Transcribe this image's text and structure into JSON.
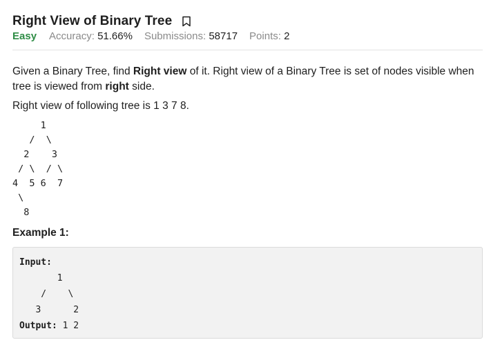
{
  "problem": {
    "title": "Right View of Binary Tree",
    "difficulty": "Easy",
    "accuracy_label": "Accuracy:",
    "accuracy_value": "51.66%",
    "submissions_label": "Submissions:",
    "submissions_value": "58717",
    "points_label": "Points:",
    "points_value": "2"
  },
  "description": {
    "p1_part1": "Given a Binary Tree, find ",
    "p1_bold1": "Right view",
    "p1_part2": " of it. Right view of a Binary Tree is set of nodes visible when tree is viewed from ",
    "p1_bold2": "right",
    "p1_part3": " side.",
    "p2": "Right view of following tree is 1 3 7 8.",
    "tree_diagram": "     1\n   /  \\\n  2    3\n / \\  / \\\n4  5 6  7\n \\\n  8"
  },
  "example1": {
    "heading": "Example 1:",
    "input_label": "Input:",
    "input_tree": "\n       1\n    /    \\\n   3      2",
    "output_label": "Output:",
    "output_value": " 1 2"
  },
  "icons": {
    "bookmark": "bookmark-icon"
  },
  "colors": {
    "difficulty_easy": "#2f8d46",
    "meta_label": "#8a8a8a",
    "code_background": "#f2f2f2"
  }
}
